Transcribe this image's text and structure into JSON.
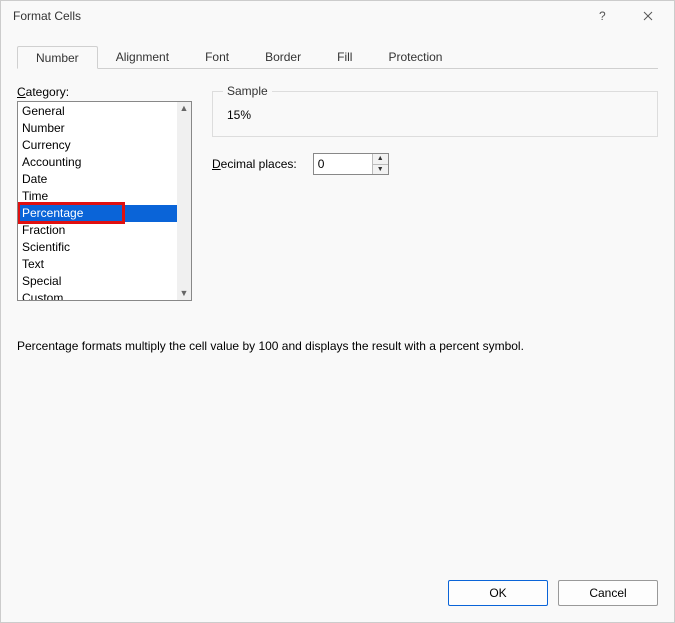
{
  "title": "Format Cells",
  "tabs": [
    {
      "label": "Number",
      "active": true
    },
    {
      "label": "Alignment",
      "active": false
    },
    {
      "label": "Font",
      "active": false
    },
    {
      "label": "Border",
      "active": false
    },
    {
      "label": "Fill",
      "active": false
    },
    {
      "label": "Protection",
      "active": false
    }
  ],
  "category_label_pre": "",
  "category_label_ul": "C",
  "category_label_post": "ategory:",
  "categories": [
    {
      "label": "General",
      "selected": false
    },
    {
      "label": "Number",
      "selected": false
    },
    {
      "label": "Currency",
      "selected": false
    },
    {
      "label": "Accounting",
      "selected": false
    },
    {
      "label": "Date",
      "selected": false
    },
    {
      "label": "Time",
      "selected": false
    },
    {
      "label": "Percentage",
      "selected": true
    },
    {
      "label": "Fraction",
      "selected": false
    },
    {
      "label": "Scientific",
      "selected": false
    },
    {
      "label": "Text",
      "selected": false
    },
    {
      "label": "Special",
      "selected": false
    },
    {
      "label": "Custom",
      "selected": false
    }
  ],
  "sample_label": "Sample",
  "sample_value": "15%",
  "decimal_label_ul": "D",
  "decimal_label_post": "ecimal places:",
  "decimal_value": "0",
  "description": "Percentage formats multiply the cell value by 100 and displays the result with a percent symbol.",
  "buttons": {
    "ok": "OK",
    "cancel": "Cancel"
  }
}
